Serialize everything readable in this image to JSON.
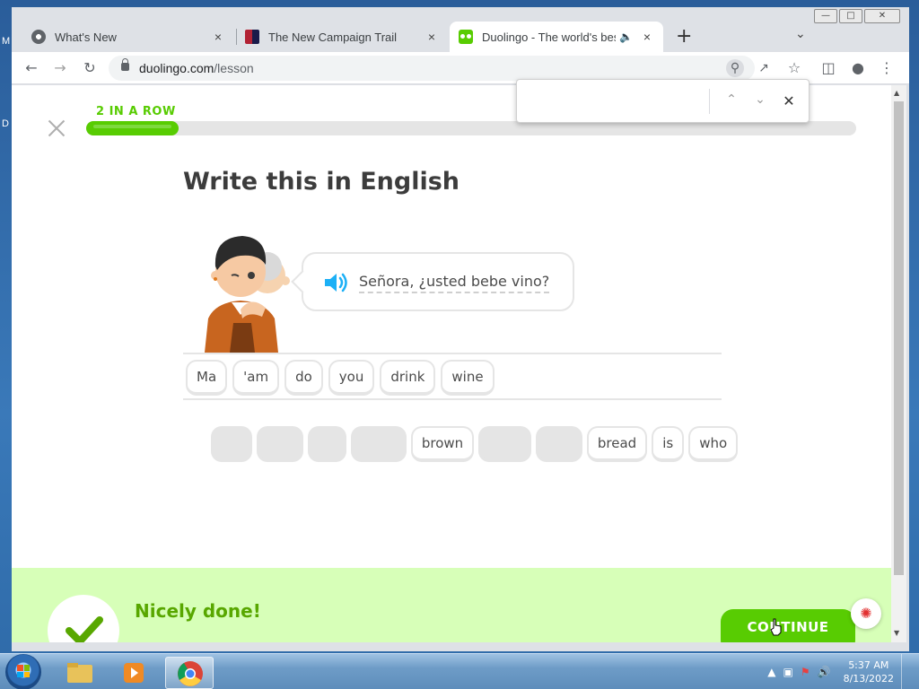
{
  "desktop": {
    "glyphs": [
      "M",
      "D"
    ]
  },
  "browser": {
    "tabs": [
      {
        "title": "What's New",
        "close": "×"
      },
      {
        "title": "The New Campaign Trail",
        "close": "×"
      },
      {
        "title": "Duolingo - The world's best",
        "close": "×"
      }
    ],
    "new_tab": "+",
    "window_controls": {
      "minimize": "—",
      "maximize": "□",
      "close": "✕"
    },
    "url": {
      "host": "duolingo.com",
      "path": "/lesson"
    }
  },
  "find_bar": {
    "prev": "⌃",
    "next": "⌄",
    "close": "✕",
    "query": ""
  },
  "lesson": {
    "streak_label": "2 IN A ROW",
    "progress_fraction": 0.12,
    "prompt": "Write this in English",
    "source_sentence": "Señora, ¿usted bebe vino?",
    "answer_words": [
      "Ma",
      "'am",
      "do",
      "you",
      "drink",
      "wine"
    ],
    "word_bank": [
      {
        "text": "Ma",
        "used": true
      },
      {
        "text": "'am",
        "used": true
      },
      {
        "text": "do",
        "used": true
      },
      {
        "text": "drink",
        "used": true
      },
      {
        "text": "brown",
        "used": false
      },
      {
        "text": "wine",
        "used": true
      },
      {
        "text": "you",
        "used": true
      },
      {
        "text": "bread",
        "used": false
      },
      {
        "text": "is",
        "used": false
      },
      {
        "text": "who",
        "used": false
      }
    ],
    "feedback": "Nicely done!",
    "continue_label": "CONTINUE",
    "colors": {
      "green": "#58cc02",
      "dark_green": "#58a700",
      "footer_bg": "#d7ffb8"
    }
  },
  "taskbar": {
    "time": "5:37 AM",
    "date": "8/13/2022"
  },
  "icons": [
    "back-icon",
    "forward-icon",
    "reload-icon",
    "lock-icon",
    "zoom-icon",
    "share-icon",
    "star-icon",
    "sidepanel-icon",
    "profile-icon",
    "menu-icon",
    "speaker-icon",
    "check-icon",
    "bug-icon"
  ]
}
